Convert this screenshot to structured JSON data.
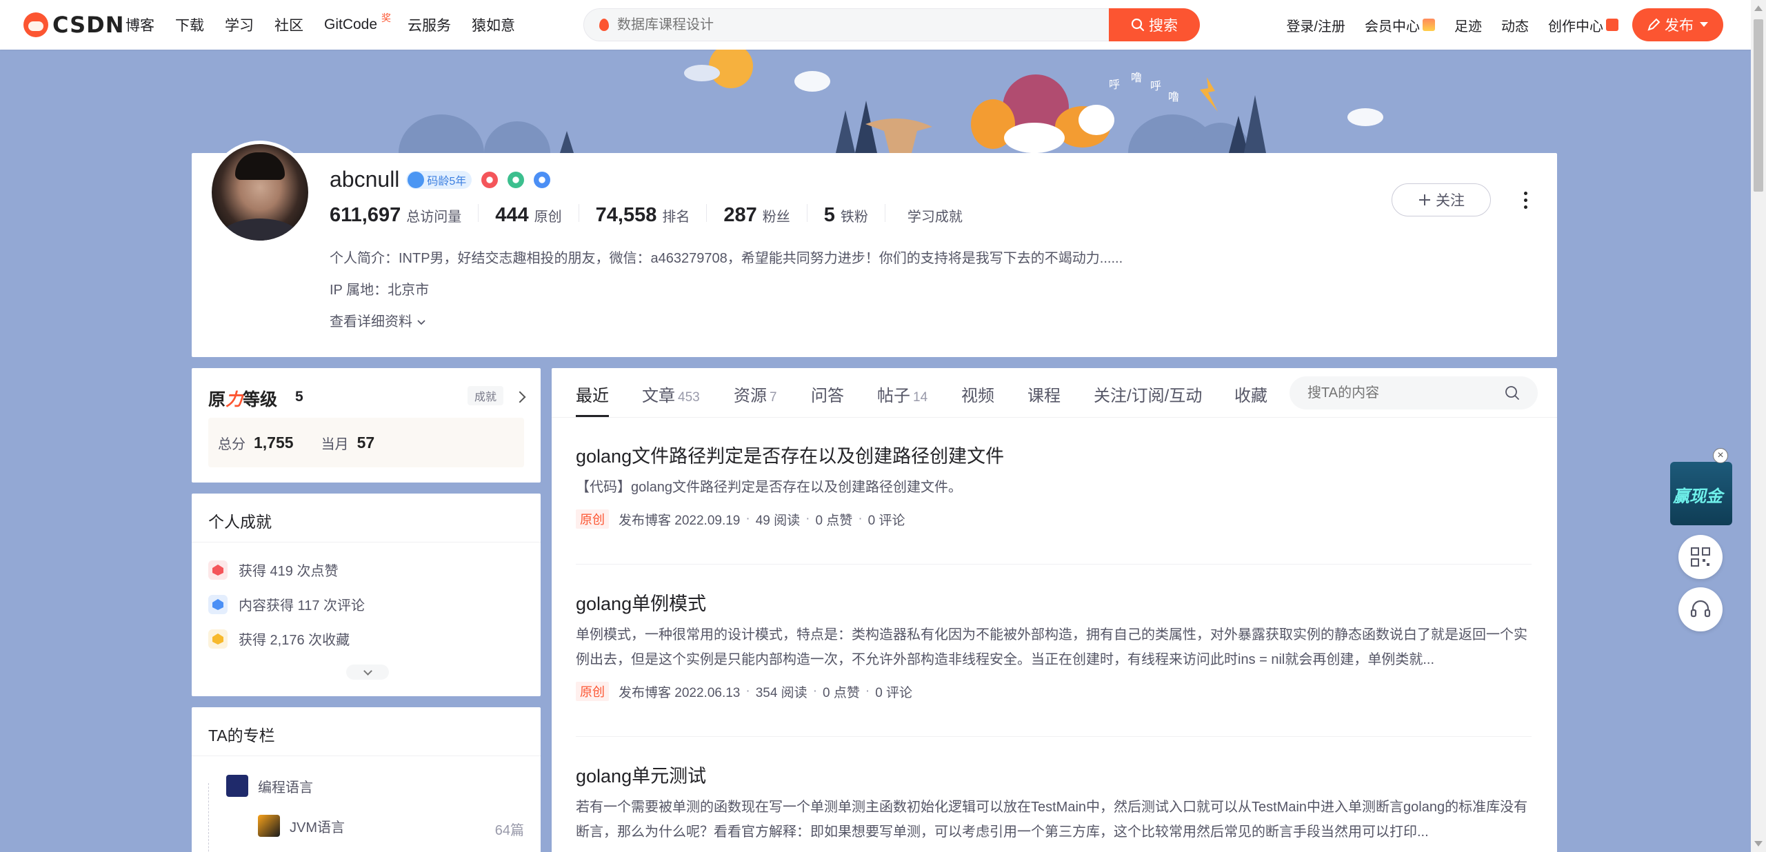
{
  "topnav": {
    "logo_text": "CSDN",
    "items": [
      {
        "label": "博客",
        "active": true
      },
      {
        "label": "下载"
      },
      {
        "label": "学习"
      },
      {
        "label": "社区"
      },
      {
        "label": "GitCode",
        "badge": "奖"
      },
      {
        "label": "云服务"
      },
      {
        "label": "猿如意"
      }
    ],
    "search_placeholder": "数据库课程设计",
    "search_button": "搜索",
    "right": {
      "login": "登录/注册",
      "vip": "会员中心",
      "footprint": "足迹",
      "dynamic": "动态",
      "creator": "创作中心",
      "publish": "发布"
    },
    "accent": "#fc5531"
  },
  "profile": {
    "username": "abcnull",
    "code_age": "码龄5年",
    "stats": [
      {
        "value": "611,697",
        "label": "总访问量"
      },
      {
        "value": "444",
        "label": "原创"
      },
      {
        "value": "74,558",
        "label": "排名"
      },
      {
        "value": "287",
        "label": "粉丝"
      },
      {
        "value": "5",
        "label": "铁粉"
      },
      {
        "value": "",
        "label": "学习成就"
      }
    ],
    "follow_button": "关注",
    "bio": "个人简介：INTP男，好结交志趣相投的朋友，微信：a463279708，希望能共同努力进步！你们的支持将是我写下去的不竭动力......",
    "ip": "IP 属地：北京市",
    "detail_link": "查看详细资料"
  },
  "level": {
    "title_prefix": "原",
    "title_red": "力",
    "title_suffix": "等级",
    "level": "5",
    "tag": "成就",
    "total_label": "总分",
    "total": "1,755",
    "month_label": "当月",
    "month": "57"
  },
  "achievements": {
    "title": "个人成就",
    "items": [
      {
        "text": "获得 419 次点赞",
        "icon": "like-icon",
        "color": "#f4555a"
      },
      {
        "text": "内容获得 117 次评论",
        "icon": "comment-icon",
        "color": "#4b8ff5"
      },
      {
        "text": "获得 2,176 次收藏",
        "icon": "favorite-icon",
        "color": "#f7b92c"
      }
    ]
  },
  "columns": {
    "title": "TA的专栏",
    "items": [
      {
        "name": "编程语言",
        "count": ""
      },
      {
        "name": "JVM语言",
        "count": "64篇"
      }
    ]
  },
  "tabs": [
    {
      "label": "最近",
      "count": "",
      "active": true
    },
    {
      "label": "文章",
      "count": "453"
    },
    {
      "label": "资源",
      "count": "7"
    },
    {
      "label": "问答",
      "count": ""
    },
    {
      "label": "帖子",
      "count": "14"
    },
    {
      "label": "视频",
      "count": ""
    },
    {
      "label": "课程",
      "count": ""
    },
    {
      "label": "关注/订阅/互动",
      "count": ""
    },
    {
      "label": "收藏",
      "count": ""
    }
  ],
  "tab_search_placeholder": "搜TA的内容",
  "articles": [
    {
      "title": "golang文件路径判定是否存在以及创建路径创建文件",
      "desc": "【代码】golang文件路径判定是否存在以及创建路径创建文件。",
      "tag": "原创",
      "date": "发布博客 2022.09.19",
      "reads": "49 阅读",
      "likes": "0 点赞",
      "comments": "0 评论"
    },
    {
      "title": "golang单例模式",
      "desc": "单例模式，一种很常用的设计模式，特点是：类构造器私有化因为不能被外部构造，拥有自己的类属性，对外暴露获取实例的静态函数说白了就是返回一个实例出去，但是这个实例是只能内部构造一次，不允许外部构造非线程安全。当正在创建时，有线程来访问此时ins = nil就会再创建，单例类就...",
      "tag": "原创",
      "date": "发布博客 2022.06.13",
      "reads": "354 阅读",
      "likes": "0 点赞",
      "comments": "0 评论"
    },
    {
      "title": "golang单元测试",
      "desc": "若有一个需要被单测的函数现在写一个单测单测主函数初始化逻辑可以放在TestMain中，然后测试入口就可以从TestMain中进入单测断言golang的标准库没有断言，那么为什么呢？看看官方解释：即如果想要写单测，可以考虑引用一个第三方库，这个比较常用然后常见的断言手段当然用可以打印...",
      "tag": "",
      "date": "",
      "reads": "",
      "likes": "",
      "comments": ""
    }
  ],
  "float": {
    "ad_text": "赢现金"
  }
}
